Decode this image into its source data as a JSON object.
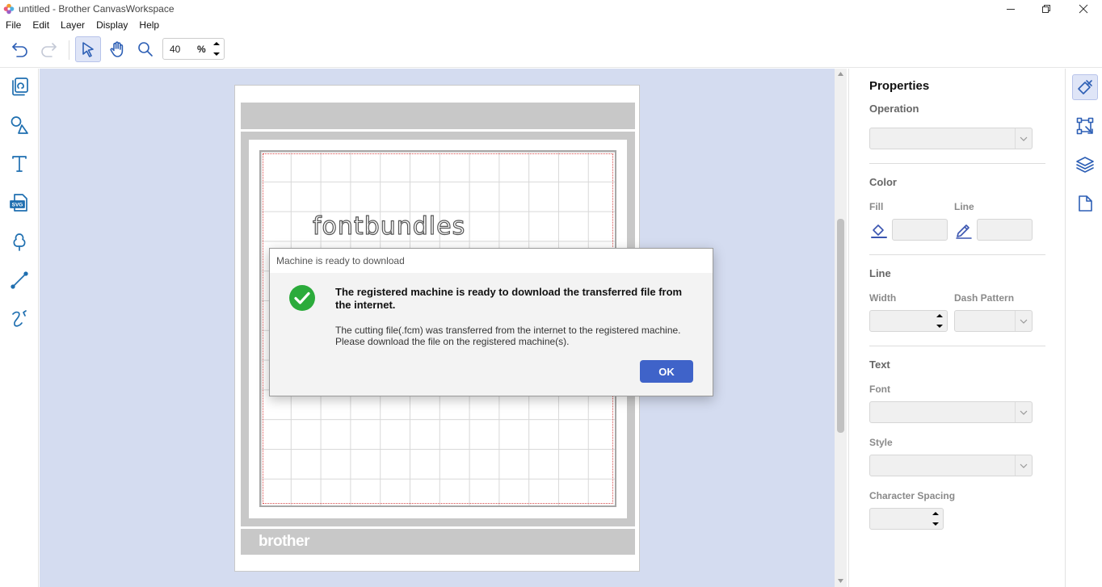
{
  "window": {
    "title": "untitled - Brother CanvasWorkspace"
  },
  "menu": {
    "items": [
      "File",
      "Edit",
      "Layer",
      "Display",
      "Help"
    ]
  },
  "toolbar": {
    "zoom_value": "40",
    "zoom_unit": "%",
    "active_tool": "select-tool"
  },
  "left_tools": [
    "templates-icon",
    "shapes-icon",
    "text-tool-icon",
    "svg-import-icon",
    "cloud-shape-icon",
    "line-tool-icon",
    "freehand-tool-icon"
  ],
  "canvas": {
    "brand_text": "brother",
    "design_text": "fontbundles",
    "background_color": "#d4dcf0",
    "cut_line_color": "#d94a4a"
  },
  "properties": {
    "title": "Properties",
    "operation_label": "Operation",
    "color_label": "Color",
    "fill_label": "Fill",
    "line_label": "Line",
    "line_section_label": "Line",
    "width_label": "Width",
    "dash_pattern_label": "Dash Pattern",
    "text_section_label": "Text",
    "font_label": "Font",
    "style_label": "Style",
    "char_spacing_label": "Character Spacing"
  },
  "right_tools": [
    "paint-icon",
    "transform-icon",
    "layers-icon",
    "page-icon"
  ],
  "dialog": {
    "title": "Machine is ready to download",
    "headline": "The registered machine is ready to download the transferred file from the internet.",
    "body_line1": "The cutting file(.fcm) was transferred from the internet to the registered machine.",
    "body_line2": "Please download the file on the registered machine(s).",
    "ok_label": "OK",
    "accent_color": "#3f63c9",
    "success_color": "#2bab3b"
  }
}
